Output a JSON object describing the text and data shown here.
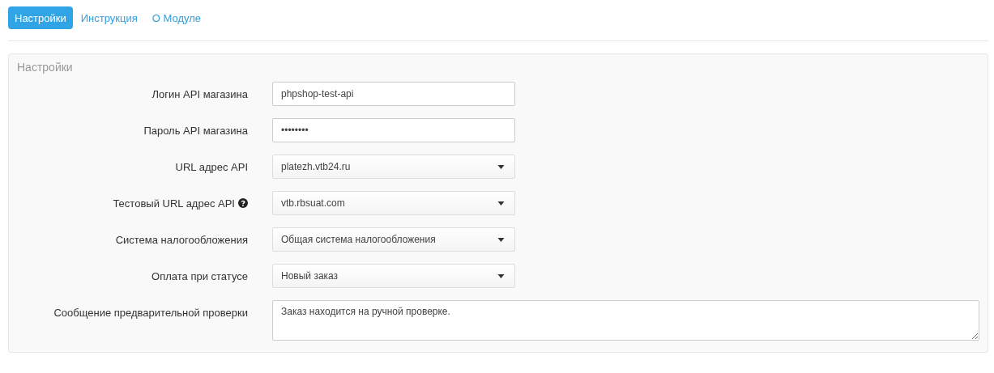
{
  "tabs": [
    {
      "label": "Настройки",
      "selected": true
    },
    {
      "label": "Инструкция",
      "selected": false
    },
    {
      "label": "О Модуле",
      "selected": false
    }
  ],
  "panel": {
    "title": "Настройки",
    "fields": [
      {
        "kind": "text",
        "label": "Логин API магазина",
        "help": false,
        "value": "phpshop-test-api"
      },
      {
        "kind": "password",
        "label": "Пароль API магазина",
        "help": false,
        "value": "••••••••"
      },
      {
        "kind": "select",
        "label": "URL адрес API",
        "help": false,
        "value": "platezh.vtb24.ru"
      },
      {
        "kind": "select",
        "label": "Тестовый URL адрес API",
        "help": true,
        "value": "vtb.rbsuat.com"
      },
      {
        "kind": "select",
        "label": "Система налогообложения",
        "help": false,
        "value": "Общая система налогообложения"
      },
      {
        "kind": "select",
        "label": "Оплата при статусе",
        "help": false,
        "value": "Новый заказ"
      },
      {
        "kind": "textarea",
        "label": "Сообщение предварительной проверки",
        "help": false,
        "value": "Заказ находится на ручной проверке."
      }
    ]
  }
}
